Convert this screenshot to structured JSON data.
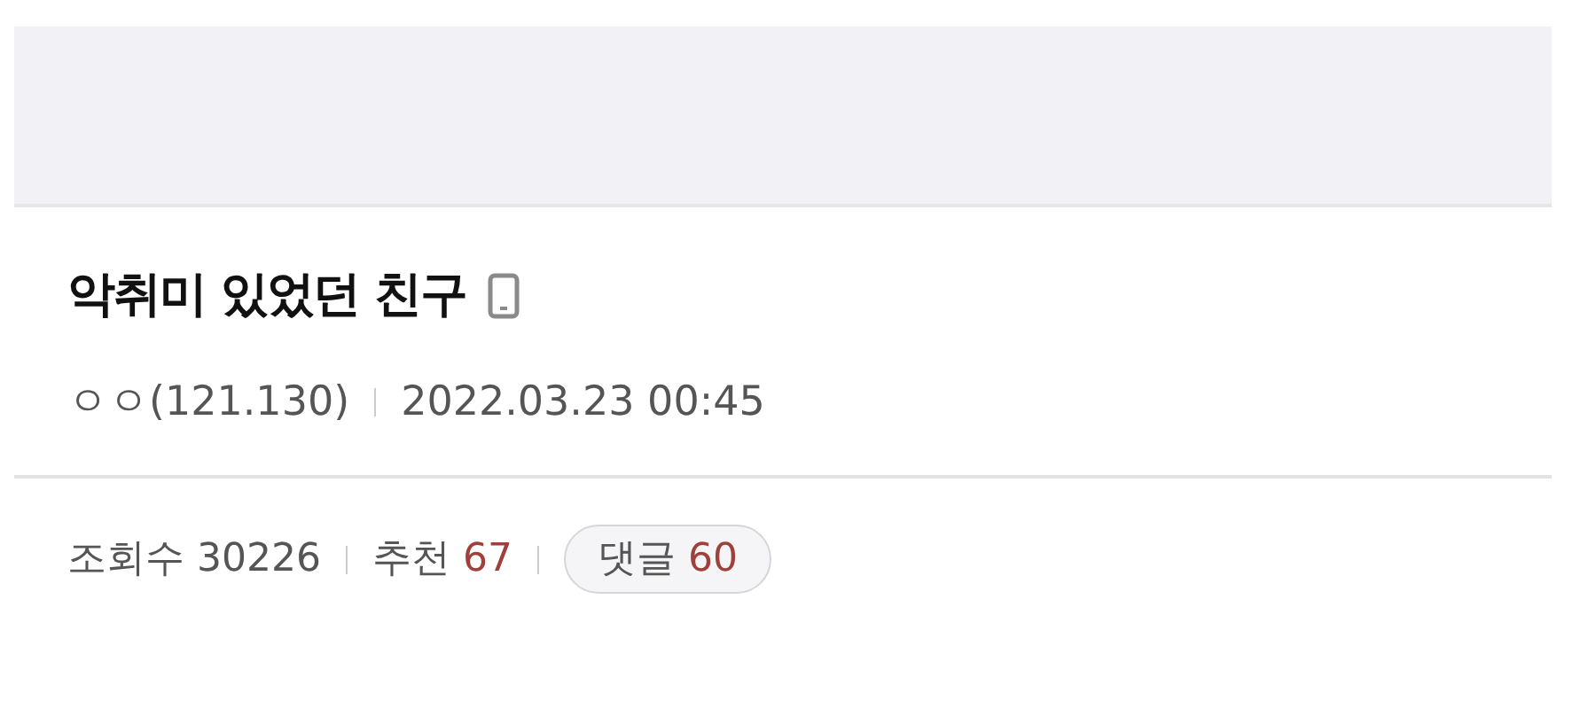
{
  "post": {
    "title": "악취미 있었던 친구",
    "mobile": true,
    "author": "ㅇㅇ(121.130)",
    "date": "2022.03.23 00:45"
  },
  "stats": [
    {
      "kind": "plain",
      "label": "조회수",
      "value": "30226"
    },
    {
      "kind": "highlight",
      "label": "추천",
      "value": "67"
    },
    {
      "kind": "pill",
      "label": "댓글",
      "value": "60"
    }
  ]
}
